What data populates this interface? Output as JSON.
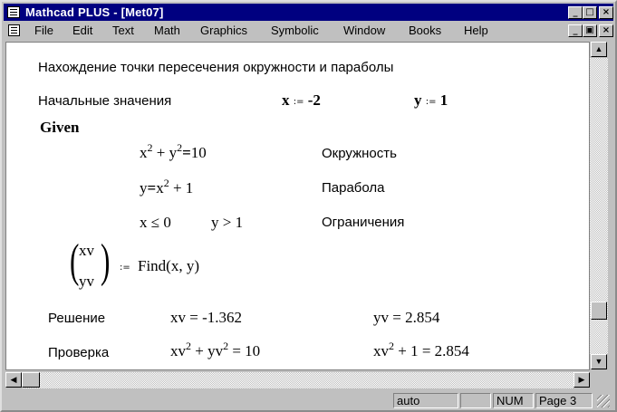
{
  "window": {
    "title": "Mathcad PLUS - [Met07]",
    "controls": [
      "_",
      "□",
      "×"
    ],
    "doc_controls": [
      "_",
      "▣",
      "×"
    ]
  },
  "menu": [
    "File",
    "Edit",
    "Text",
    "Math",
    "Graphics",
    "Symbolic",
    "Window",
    "Books",
    "Help"
  ],
  "document": {
    "heading": "Нахождение точки пересечения окружности и параболы",
    "initial_label": "Начальные значения",
    "x_init": {
      "var": "x",
      "op": ":=",
      "value": "-2"
    },
    "y_init": {
      "var": "y",
      "op": ":=",
      "value": "1"
    },
    "given": "Given",
    "eq1": {
      "lhs_a": "x",
      "exp": "2",
      "plus": "+",
      "lhs_b": "y",
      "exp2": "2",
      "eq": "=",
      "rhs": "10",
      "label": "Окружность"
    },
    "eq2": {
      "lhs": "y",
      "eq": "=",
      "rhs_a": "x",
      "exp": "2",
      "plus": "+",
      "rhs_b": "1",
      "label": "Парабола"
    },
    "constraints": {
      "c1": "x ≤ 0",
      "c2": "y > 1",
      "label": "Ограничения"
    },
    "find": {
      "v1": "xv",
      "v2": "yv",
      "op": ":=",
      "expr": "Find(x, y)"
    },
    "solution": {
      "label": "Решение",
      "xv": "xv = -1.362",
      "yv": "yv = 2.854"
    },
    "check": {
      "label": "Проверка",
      "left_a": "xv",
      "exp": "2",
      "plus": "+",
      "left_b": "yv",
      "exp2": "2",
      "left_rhs": "= 10",
      "right_a": "xv",
      "exp3": "2",
      "plus2": "+",
      "right_b": "1",
      "right_rhs": "= 2.854"
    }
  },
  "status": {
    "mode": "auto",
    "numlock": "NUM",
    "page": "Page 3"
  }
}
